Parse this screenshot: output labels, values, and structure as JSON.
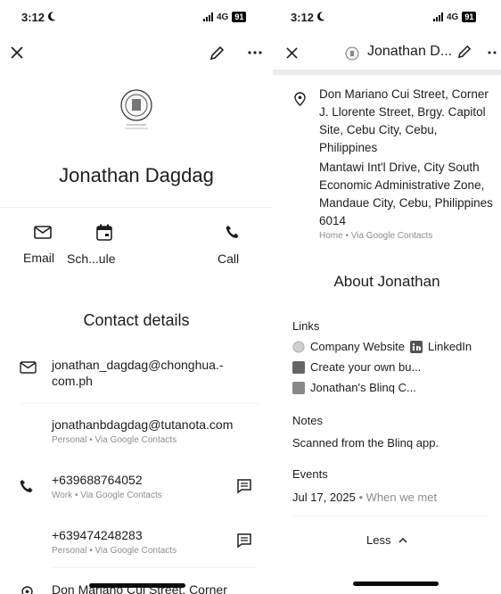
{
  "left": {
    "status": {
      "time": "3:12",
      "network": "4G",
      "battery": "91"
    },
    "contact_name": "Jonathan Dagdag",
    "actions": [
      {
        "label": "Email",
        "icon": "mail-icon"
      },
      {
        "label": "Sch...ule",
        "icon": "calendar-icon"
      },
      {
        "label": "Call",
        "icon": "phone-icon"
      }
    ],
    "contact_details_title": "Contact details",
    "emails": [
      {
        "value": "jonathan_dagdag@chonghua.-com.ph",
        "sub": ""
      },
      {
        "value": "jonathanbdagdag@tutanota.com",
        "sub": "Personal • Via Google Contacts"
      }
    ],
    "phones": [
      {
        "value": "+639688764052",
        "sub": "Work • Via Google Contacts"
      },
      {
        "value": "+639474248283",
        "sub": "Personal • Via Google Contacts"
      }
    ],
    "address_preview": "Don Mariano Cui Street, Corner"
  },
  "right": {
    "status": {
      "time": "3:12",
      "network": "4G",
      "battery": "91"
    },
    "header_name": "Jonathan D...",
    "addresses": [
      {
        "value": "Don Mariano Cui Street, Corner J. Llorente Street, Brgy. Capitol Site, Cebu City, Cebu, Philippines"
      },
      {
        "value": "Mantawi Int'l Drive, City South Economic Administrative Zone, Mandaue City, Cebu, Philippines 6014",
        "sub": "Home • Via Google Contacts"
      }
    ],
    "about_title": "About Jonathan",
    "links_label": "Links",
    "links": {
      "company": "Company Website",
      "linkedin": "LinkedIn",
      "create": "Create your own bu...",
      "blinq": "Jonathan's Blinq C..."
    },
    "notes_label": "Notes",
    "notes_value": "Scanned from the Blinq app.",
    "events_label": "Events",
    "event_date": "Jul 17, 2025",
    "event_desc": "• When we met",
    "less_label": "Less"
  }
}
